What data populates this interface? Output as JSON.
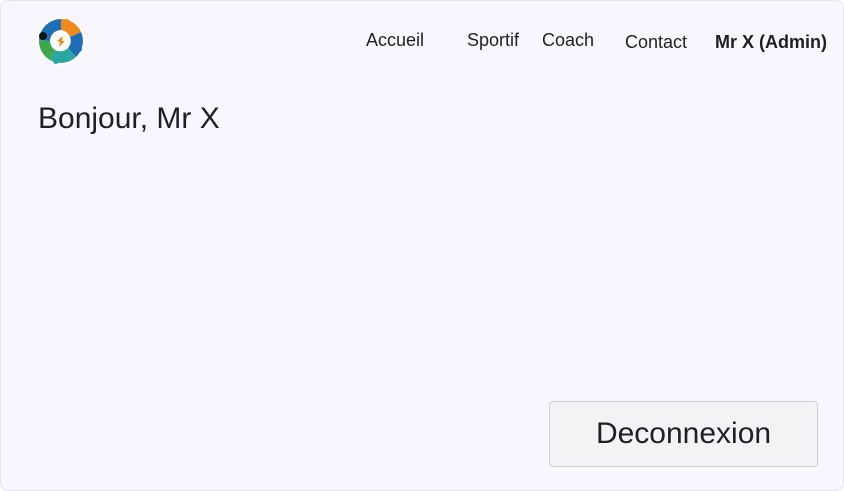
{
  "header": {
    "logo_icon": "circular-people-logo-icon",
    "nav": {
      "accueil": "Accueil",
      "sportif": "Sportif",
      "coach": "Coach",
      "contact": "Contact",
      "user": "Mr X (Admin)"
    }
  },
  "main": {
    "greeting": "Bonjour, Mr X",
    "logout_label": "Deconnexion"
  },
  "colors": {
    "background": "#f8f6fe",
    "logo_blue": "#1f6fb6",
    "logo_orange": "#f08a1c",
    "logo_teal": "#2aa7a0",
    "logo_green": "#3da84b",
    "button_bg": "#f3f2f5"
  }
}
